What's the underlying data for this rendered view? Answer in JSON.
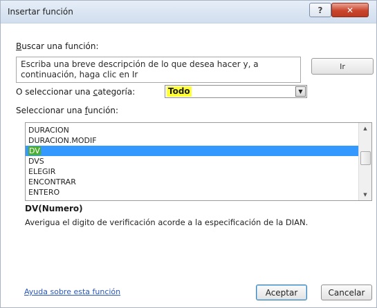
{
  "window": {
    "title": "Insertar función",
    "help_glyph": "?",
    "close_glyph": "✕"
  },
  "search": {
    "label_accel": "B",
    "label_rest": "uscar una función:",
    "text": "Escriba una breve descripción de lo que desea hacer y, a\ncontinuación, haga clic en Ir",
    "go_glyph": "Ir"
  },
  "category": {
    "label_pre": "O seleccionar una ",
    "label_accel": "c",
    "label_post": "ategoría:",
    "value": "Todo",
    "highlight_color": "#ffff33"
  },
  "functions": {
    "label_pre": "Seleccionar una ",
    "label_accel": "f",
    "label_post": "unción:",
    "items": [
      "DURACION",
      "DURACION.MODIF",
      "DV",
      "DVS",
      "ELEGIR",
      "ENCONTRAR",
      "ENTERO"
    ],
    "selected": "DV",
    "selected_color": "#3399ff"
  },
  "details": {
    "signature": "DV(Numero)",
    "description": "Averigua el digito de verificación acorde a la especificación de la DIAN."
  },
  "footer": {
    "help_link": "Ayuda sobre esta función",
    "ok_label": "Aceptar",
    "cancel_label": "Cancelar"
  }
}
